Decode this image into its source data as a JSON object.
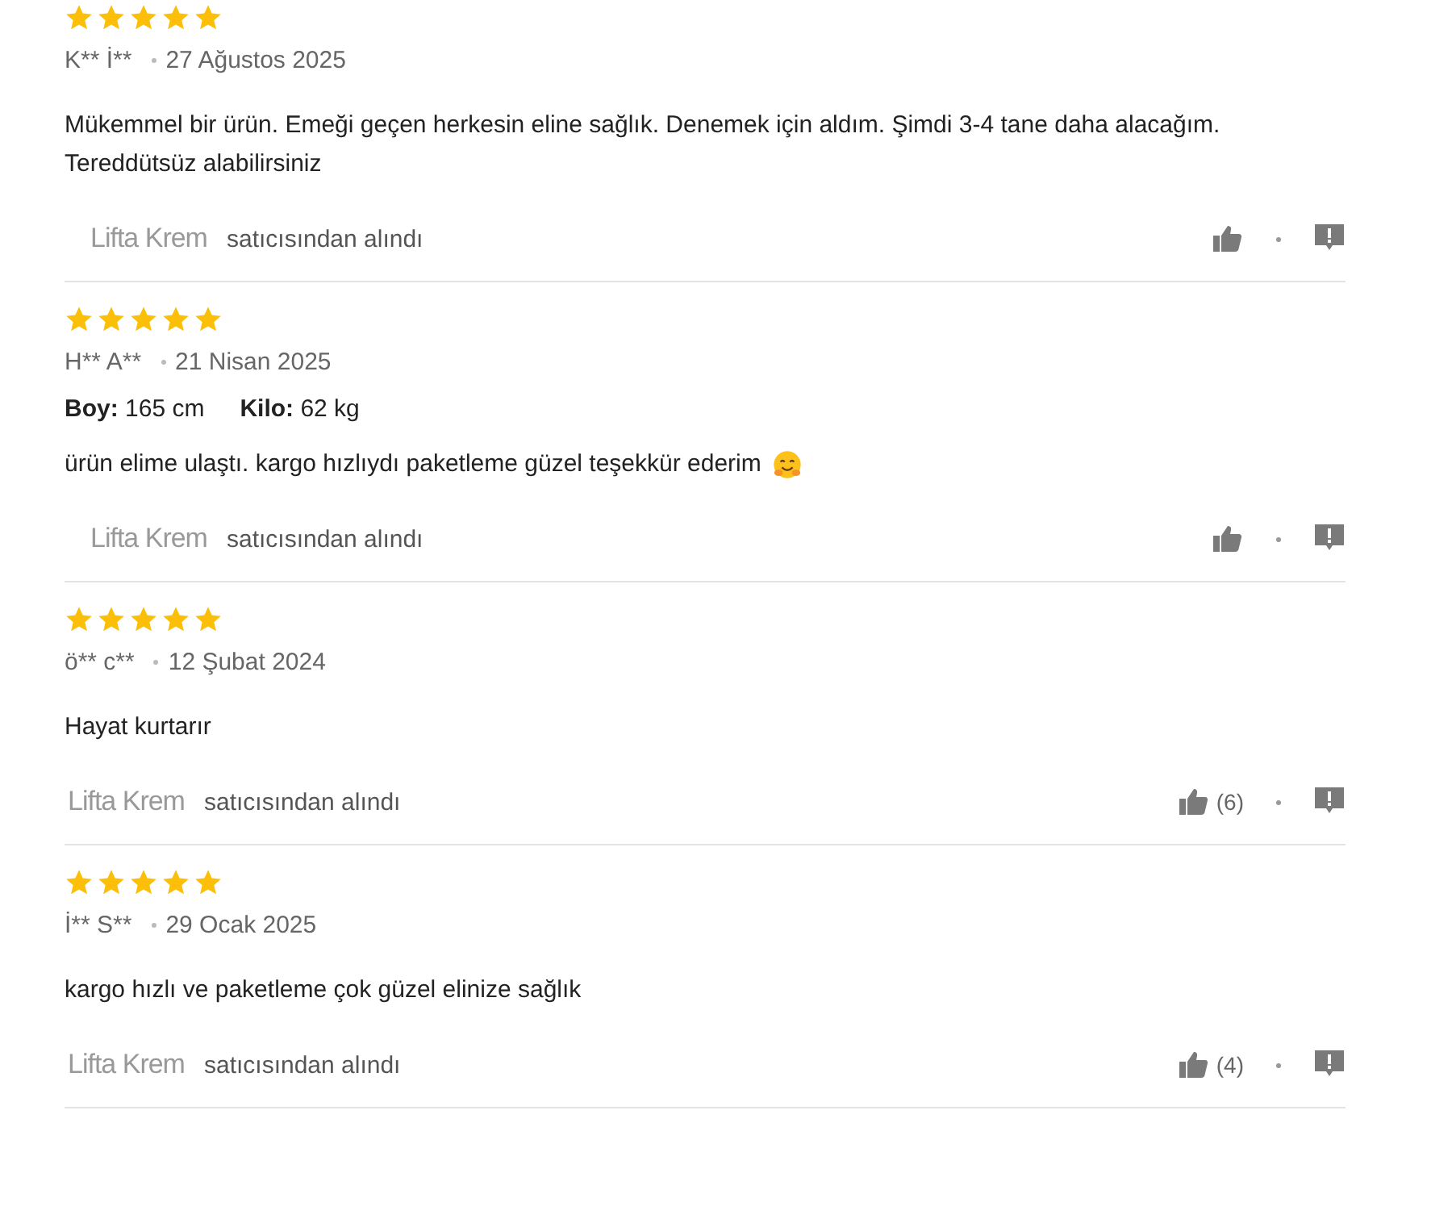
{
  "reviews": [
    {
      "stars": 5,
      "author": "K** İ**",
      "date": "27 Ağustos 2025",
      "text": "Mükemmel bir ürün. Emeği geçen herkesin eline sağlık. Denemek için aldım. Şimdi 3-4 tane daha alacağım. Tereddütsüz alabilirsiniz",
      "seller": "Lifta Krem",
      "seller_note": "satıcısından alındı"
    },
    {
      "stars": 5,
      "author": "H** A**",
      "date": "21 Nisan 2025",
      "attributes": [
        {
          "label": "Boy:",
          "value": "165 cm"
        },
        {
          "label": "Kilo:",
          "value": "62 kg"
        }
      ],
      "text": "ürün elime ulaştı. kargo hızlıydı paketleme güzel teşekkür ederim",
      "emoji": true,
      "seller": "Lifta Krem",
      "seller_note": "satıcısından alındı"
    },
    {
      "stars": 5,
      "author": "ö** c**",
      "date": "12 Şubat 2024",
      "text": "Hayat kurtarır",
      "seller": "Lifta Krem",
      "seller_note": "satıcısından alındı",
      "likes": "(6)"
    },
    {
      "stars": 5,
      "author": "İ** S**",
      "date": "29 Ocak 2025",
      "text": "kargo hızlı ve paketleme çok güzel elinize sağlık",
      "seller": "Lifta Krem",
      "seller_note": "satıcısından alındı",
      "likes": "(4)"
    }
  ]
}
